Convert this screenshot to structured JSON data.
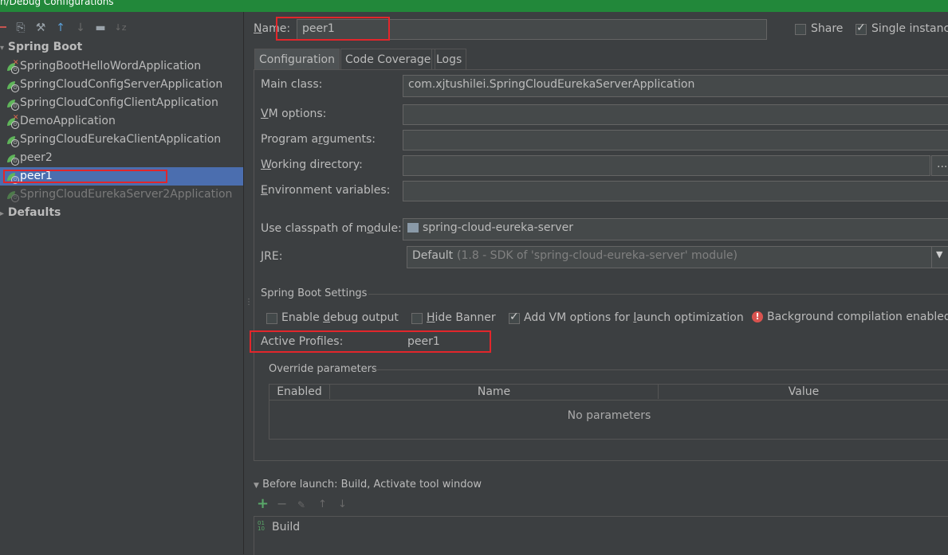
{
  "window": {
    "title": "n/Debug Configurations"
  },
  "tree": {
    "groups": [
      {
        "label": "Spring Boot"
      },
      {
        "label": "Defaults"
      }
    ],
    "items": [
      {
        "label": "SpringBootHelloWordApplication",
        "status": "error"
      },
      {
        "label": "SpringCloudConfigServerApplication",
        "status": "ok"
      },
      {
        "label": "SpringCloudConfigClientApplication",
        "status": "ok"
      },
      {
        "label": "DemoApplication",
        "status": "error"
      },
      {
        "label": "SpringCloudEurekaClientApplication",
        "status": "ok"
      },
      {
        "label": "peer2",
        "status": "ok"
      },
      {
        "label": "peer1",
        "status": "selected"
      },
      {
        "label": "SpringCloudEurekaServer2Application",
        "status": "disabled"
      }
    ]
  },
  "header": {
    "name_label": "Name:",
    "name_value": "peer1",
    "share_label": "Share",
    "share_checked": false,
    "single_instance_label": "Single instance",
    "single_instance_checked": true
  },
  "tabs": [
    {
      "label": "Configuration",
      "active": true
    },
    {
      "label": "Code Coverage",
      "active": false
    },
    {
      "label": "Logs",
      "active": false
    }
  ],
  "config": {
    "main_class_label": "Main class:",
    "main_class_value": "com.xjtushilei.SpringCloudEurekaServerApplication",
    "vm_options_label": "VM options:",
    "vm_options_value": "",
    "program_args_label": "Program arguments:",
    "program_args_value": "",
    "working_dir_label": "Working directory:",
    "working_dir_value": "",
    "browse_label": "...",
    "env_vars_label": "Environment variables:",
    "env_vars_value": "",
    "classpath_label": "Use classpath of module:",
    "classpath_value": "spring-cloud-eureka-server",
    "jre_label": "JRE:",
    "jre_value": "Default",
    "jre_detail": "(1.8 - SDK of 'spring-cloud-eureka-server' module)"
  },
  "spring_boot": {
    "section_title": "Spring Boot Settings",
    "enable_debug_label": "Enable debug output",
    "enable_debug_checked": false,
    "hide_banner_label": "Hide Banner",
    "hide_banner_checked": false,
    "add_vm_label": "Add VM options for launch optimization",
    "add_vm_checked": true,
    "background_label": "Background compilation enabled",
    "active_profiles_label": "Active Profiles:",
    "active_profiles_value": "peer1"
  },
  "override": {
    "title": "Override parameters",
    "columns": [
      "Enabled",
      "Name",
      "Value"
    ],
    "empty_text": "No parameters"
  },
  "before_launch": {
    "title": "Before launch: Build, Activate tool window",
    "items": [
      "Build"
    ]
  },
  "colors": {
    "title_bar": "#22883a",
    "selection": "#4b6eaf",
    "highlight_box": "#e2262b",
    "background": "#3c3f41"
  }
}
